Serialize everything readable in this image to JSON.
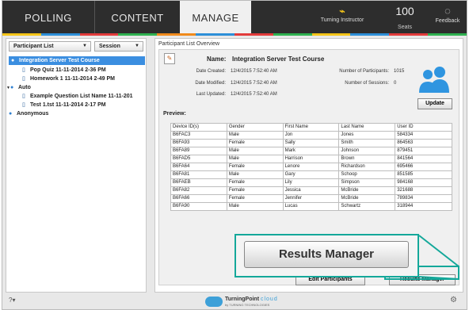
{
  "nav": {
    "tabs": [
      {
        "label": "POLLING"
      },
      {
        "label": "CONTENT"
      },
      {
        "label": "MANAGE"
      }
    ],
    "instructor_label": "Turning Instructor",
    "instructor_icon": "receiver-icon",
    "seats_count": "100",
    "seats_label": "Seats",
    "feedback_label": "Feedback",
    "feedback_icon": "speech-bubble-icon",
    "strip_colors": [
      "#f5c518",
      "#2d8fd8",
      "#e23b3b",
      "#2fb150",
      "#f08a1c",
      "#2d8fd8",
      "#e23b3b",
      "#2fb150",
      "#f5c518",
      "#2d8fd8",
      "#e23b3b",
      "#2fb150"
    ]
  },
  "sidebar": {
    "dropdown1": "Participant List",
    "dropdown2": "Session",
    "tree": [
      {
        "label": "Integration Server Test Course",
        "icon": "users-icon",
        "selected": true
      },
      {
        "label": "Pop Quiz 11-11-2014 2-36 PM",
        "icon": "document-icon"
      },
      {
        "label": "Homework 1 11-11-2014 2-49 PM",
        "icon": "document-icon"
      },
      {
        "label": "Auto",
        "icon": "users-icon"
      },
      {
        "label": "Example Question List Name 11-11-201",
        "icon": "document-icon"
      },
      {
        "label": "Test 1.tst 11-11-2014 2-17 PM",
        "icon": "document-icon"
      },
      {
        "label": "Anonymous",
        "icon": "users-icon"
      }
    ]
  },
  "main": {
    "overview_title": "Participant List Overview",
    "name_label": "Name:",
    "name_value": "Integration Server Test Course",
    "date_created_label": "Date Created:",
    "date_created": "12/4/2015 7:52:40 AM",
    "date_modified_label": "Date Modified:",
    "date_modified": "12/4/2015 7:52:40 AM",
    "last_updated_label": "Last Updated:",
    "last_updated": "12/4/2015 7:52:40 AM",
    "participants_label": "Number of Participants:",
    "participants_value": "1015",
    "sessions_label": "Number of Sessions:",
    "sessions_value": "0",
    "update_button": "Update",
    "preview_label": "Preview:",
    "table": {
      "headers": [
        "Device ID(s)",
        "Gender",
        "First Name",
        "Last Name",
        "User ID"
      ],
      "rows": [
        [
          "B6FAC3",
          "Male",
          "Jon",
          "Jones",
          "584334"
        ],
        [
          "B6FA93",
          "Female",
          "Sally",
          "Smith",
          "864563"
        ],
        [
          "B6FA89",
          "Male",
          "Mark",
          "Johnson",
          "879451"
        ],
        [
          "B6FAD5",
          "Male",
          "Harrison",
          "Brown",
          "841564"
        ],
        [
          "B6FA64",
          "Female",
          "Lenore",
          "Richardson",
          "695466"
        ],
        [
          "B6FA81",
          "Male",
          "Gary",
          "Schoop",
          "851585"
        ],
        [
          "B6FAEB",
          "Female",
          "Lily",
          "Simpson",
          "984168"
        ],
        [
          "B6FA82",
          "Female",
          "Jessica",
          "McBride",
          "321688"
        ],
        [
          "B6FA66",
          "Female",
          "Jennifer",
          "McBride",
          "789834"
        ],
        [
          "B6FA90",
          "Male",
          "Lucas",
          "Schwartz",
          "318944"
        ]
      ]
    },
    "edit_participants_button": "Edit Participants",
    "results_manager_button": "Results Manager",
    "callout_label": "Results Manager",
    "callout_color": "#14a89a"
  },
  "footer": {
    "help_icon": "help-icon",
    "help_label": "?",
    "logo_text": "TurningPoint",
    "logo_text2": "cloud",
    "logo_sub": "by TURNING TECHNOLOGIES",
    "settings_icon": "gear-icon"
  }
}
